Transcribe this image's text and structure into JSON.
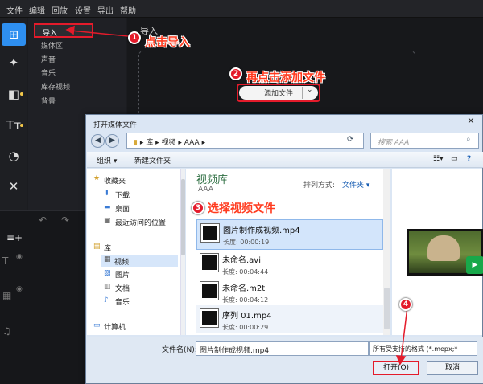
{
  "menu": [
    "文件",
    "编辑",
    "回放",
    "设置",
    "导出",
    "帮助"
  ],
  "sidebar": {
    "items": [
      "导入",
      "媒体区",
      "声音",
      "音乐",
      "库存视频",
      "背景"
    ]
  },
  "import": {
    "title": "导入",
    "add_button": "添加文件"
  },
  "annotations": {
    "step1": "点击导入",
    "step2": "再点击添加文件",
    "step3": "选择视频文件",
    "nums": [
      "1",
      "2",
      "3",
      "4"
    ]
  },
  "dialog": {
    "title": "打开媒体文件",
    "close": "✕",
    "breadcrumb": [
      "库",
      "视频",
      "AAA"
    ],
    "search_placeholder": "搜索 AAA",
    "toolbar": {
      "organize": "组织 ▾",
      "new_folder": "新建文件夹"
    },
    "nav": {
      "favorites": "收藏夹",
      "downloads": "下载",
      "desktop": "桌面",
      "recent": "最近访问的位置",
      "libraries": "库",
      "videos": "视频",
      "pictures": "图片",
      "documents": "文档",
      "music": "音乐",
      "computer": "计算机"
    },
    "library": {
      "title": "视频库",
      "subtitle": "AAA",
      "sort_label": "排列方式:",
      "sort_value": "文件夹 ▾"
    },
    "files": [
      {
        "name": "图片制作成视频.mp4",
        "duration": "长度: 00:00:19"
      },
      {
        "name": "未命名.avi",
        "duration": "长度: 00:04:44"
      },
      {
        "name": "未命名.m2t",
        "duration": "长度: 00:04:12"
      },
      {
        "name": "序列 01.mp4",
        "duration": "长度: 00:00:29"
      }
    ],
    "filename_label": "文件名(N):",
    "filename_value": "图片制作成视频.mp4",
    "filetype": "所有受支持的格式 (*.mepx;*",
    "open": "打开(O)",
    "cancel": "取消"
  }
}
